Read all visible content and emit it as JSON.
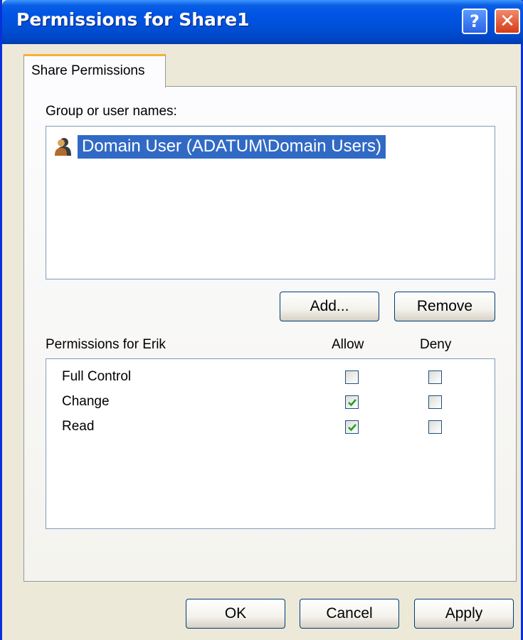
{
  "window": {
    "title": "Permissions for Share1"
  },
  "tabs": [
    {
      "label": "Share Permissions"
    }
  ],
  "group_label": "Group or user names:",
  "users": [
    {
      "name": "Domain User (ADATUM\\Domain Users)",
      "selected": true
    }
  ],
  "buttons": {
    "add": "Add...",
    "remove": "Remove",
    "ok": "OK",
    "cancel": "Cancel",
    "apply": "Apply"
  },
  "permissions": {
    "header": "Permissions for Erik",
    "allow_header": "Allow",
    "deny_header": "Deny",
    "rows": [
      {
        "name": "Full Control",
        "allow": false,
        "deny": false
      },
      {
        "name": "Change",
        "allow": true,
        "deny": false
      },
      {
        "name": "Read",
        "allow": true,
        "deny": false
      }
    ]
  },
  "colors": {
    "title_bar": "#0055e5",
    "selection": "#316ac5",
    "tab_accent": "#f5b03c",
    "check": "#21a121"
  },
  "icons": {
    "help": "help-icon",
    "close": "close-icon",
    "user": "user-group-icon"
  }
}
